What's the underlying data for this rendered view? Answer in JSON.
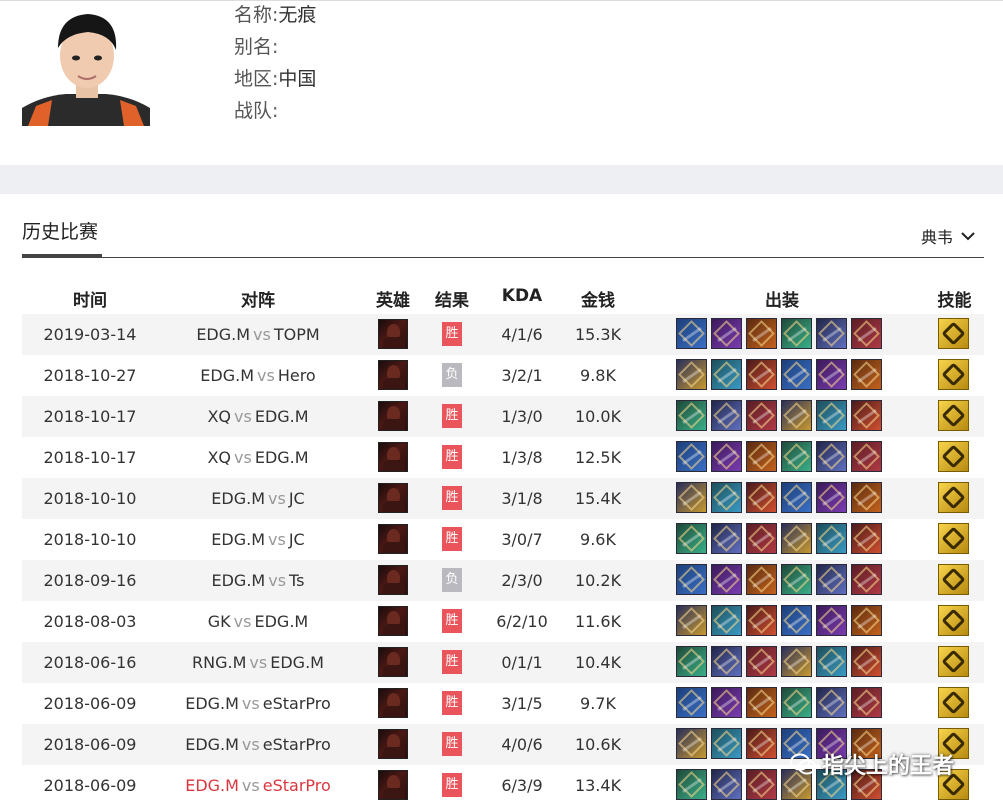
{
  "player": {
    "name_label": "名称:",
    "name": "无痕",
    "alias_label": "别名:",
    "alias": "",
    "region_label": "地区:",
    "region": "中国",
    "team_label": "战队:",
    "team": ""
  },
  "section": {
    "title": "历史比赛",
    "hero_filter": "典韦"
  },
  "table": {
    "headers": {
      "time": "时间",
      "match": "对阵",
      "hero": "英雄",
      "result": "结果",
      "kda": "KDA",
      "gold": "金钱",
      "items": "出装",
      "skill": "技能"
    },
    "vs": "vs",
    "rows": [
      {
        "date": "2019-03-14",
        "team_a": "EDG.M",
        "team_b": "TOPM",
        "result": "胜",
        "kda": "4/1/6",
        "gold": "15.3K"
      },
      {
        "date": "2018-10-27",
        "team_a": "EDG.M",
        "team_b": "Hero",
        "result": "负",
        "kda": "3/2/1",
        "gold": "9.8K"
      },
      {
        "date": "2018-10-17",
        "team_a": "XQ",
        "team_b": "EDG.M",
        "result": "胜",
        "kda": "1/3/0",
        "gold": "10.0K"
      },
      {
        "date": "2018-10-17",
        "team_a": "XQ",
        "team_b": "EDG.M",
        "result": "胜",
        "kda": "1/3/8",
        "gold": "12.5K"
      },
      {
        "date": "2018-10-10",
        "team_a": "EDG.M",
        "team_b": "JC",
        "result": "胜",
        "kda": "3/1/8",
        "gold": "15.4K"
      },
      {
        "date": "2018-10-10",
        "team_a": "EDG.M",
        "team_b": "JC",
        "result": "胜",
        "kda": "3/0/7",
        "gold": "9.6K"
      },
      {
        "date": "2018-09-16",
        "team_a": "EDG.M",
        "team_b": "Ts",
        "result": "负",
        "kda": "2/3/0",
        "gold": "10.2K"
      },
      {
        "date": "2018-08-03",
        "team_a": "GK",
        "team_b": "EDG.M",
        "result": "胜",
        "kda": "6/2/10",
        "gold": "11.6K"
      },
      {
        "date": "2018-06-16",
        "team_a": "RNG.M",
        "team_b": "EDG.M",
        "result": "胜",
        "kda": "0/1/1",
        "gold": "10.4K"
      },
      {
        "date": "2018-06-09",
        "team_a": "EDG.M",
        "team_b": "eStarPro",
        "result": "胜",
        "kda": "3/1/5",
        "gold": "9.7K"
      },
      {
        "date": "2018-06-09",
        "team_a": "EDG.M",
        "team_b": "eStarPro",
        "result": "胜",
        "kda": "4/0/6",
        "gold": "10.6K"
      },
      {
        "date": "2018-06-09",
        "team_a": "EDG.M",
        "team_b": "eStarPro",
        "result": "胜",
        "kda": "6/3/9",
        "gold": "13.4K"
      }
    ]
  },
  "watermark": "指尖上的王者",
  "colors": {
    "win": "#e9555b",
    "loss": "#b9b9bf",
    "highlight_team": "#d9363e"
  }
}
